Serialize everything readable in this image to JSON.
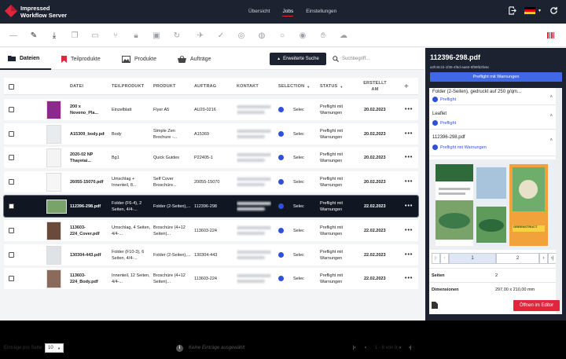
{
  "header": {
    "brand_line1": "Impressed",
    "brand_line2": "Workflow Server",
    "nav": [
      "Übersicht",
      "Jobs",
      "Einstellungen"
    ],
    "nav_active": "Jobs"
  },
  "tabs": [
    "Dateien",
    "Teilprodukte",
    "Produkte",
    "Aufträge"
  ],
  "advanced_search_label": "Erweiterte Suche",
  "search_placeholder": "Suchbegriff...",
  "columns": [
    "DATEI",
    "TEILPRODUKT",
    "PRODUKT",
    "AUFTRAG",
    "KONTAKT",
    "SELECTION",
    "STATUS",
    "ERSTELLT AM"
  ],
  "rows": [
    {
      "file": "200 x Noveno_Pla...",
      "part": "Einzelblatt",
      "product": "Flyer A5",
      "order": "AU20-0216",
      "selection": "Selection",
      "status": "Preflight mit Warnungen",
      "date": "20.02.2023"
    },
    {
      "file": "A15309_body.pdf",
      "part": "Body",
      "product": "Simple Zen Brochure -...",
      "order": "A15369",
      "selection": "Selection",
      "status": "Preflight mit Warnungen",
      "date": "20.02.2023"
    },
    {
      "file": "2020-02 NP Thayetai...",
      "part": "Bg1",
      "product": "Quick Guides",
      "order": "P22405-1",
      "selection": "Selection",
      "status": "Preflight mit Warnungen",
      "date": "20.02.2023"
    },
    {
      "file": "26055-15070.pdf",
      "part": "Umschlag + Innenteil, 8...",
      "product": "Self Cover Broschüre...",
      "order": "20055-15070",
      "selection": "Selection",
      "status": "Preflight mit Warnungen",
      "date": "20.02.2023"
    },
    {
      "file": "112396-298.pdf",
      "part": "Folder (F6-4), 2 Seiten, 4/4-...",
      "product": "Folder (2-Seiten),...",
      "order": "112396-298",
      "selection": "Selection",
      "status": "Preflight mit Warnungen",
      "date": "22.02.2023"
    },
    {
      "file": "113603-224_Cover.pdf",
      "part": "Umschlag, 4 Seiten, 4/4-...",
      "product": "Broschüre (4+12 Seiten)...",
      "order": "113603-224",
      "selection": "Selection",
      "status": "Preflight mit Warnungen",
      "date": "22.02.2023"
    },
    {
      "file": "130304-443.pdf",
      "part": "Folder (F10-3), 6 Seiten, 4/4-...",
      "product": "Folder (2-Seiten),...",
      "order": "130304-443",
      "selection": "Selection",
      "status": "Preflight mit Warnungen",
      "date": "22.02.2023"
    },
    {
      "file": "113603-224_Body.pdf",
      "part": "Innenteil, 12 Seiten, 4/4-...",
      "product": "Broschüre (4+12 Seiten)...",
      "order": "113603-224",
      "selection": "Selection",
      "status": "Preflight mit Warnungen",
      "date": "22.02.2023"
    }
  ],
  "selected_row": 4,
  "footer": {
    "per_page_label": "Einträge pro Seite",
    "per_page_value": "10",
    "no_selection": "Keine Einträge ausgewählt",
    "range": "1 - 8 von 8"
  },
  "detail": {
    "title": "112396-298.pdf",
    "subtitle": "a2fc8c1b-1f35-4f5d-aa60-6f99fd2fa5c",
    "preflight_button": "Preflight mit Warnungen",
    "groups": [
      {
        "title": "Folder (2-Seiten), gedruckt auf 250 g/qm...",
        "status": "Preflight"
      },
      {
        "title": "Leaflet",
        "status": "Preflight"
      },
      {
        "title": "112396-298.pdf",
        "status": "Preflight mit Warnungen"
      }
    ],
    "pages": [
      "1",
      "2"
    ],
    "seiten_label": "Seiten",
    "seiten_value": "2",
    "dim_label": "Dimensionen",
    "dim_value": "297,00 x 210,00 mm",
    "editor_button": "Öffnen im Editor",
    "preview_badge": "GREENSTRUCT"
  },
  "colors": {
    "dark": "#1c2230",
    "accent_red": "#e0263a",
    "blue": "#3f67e6",
    "status_dot": "#2f50d8"
  }
}
